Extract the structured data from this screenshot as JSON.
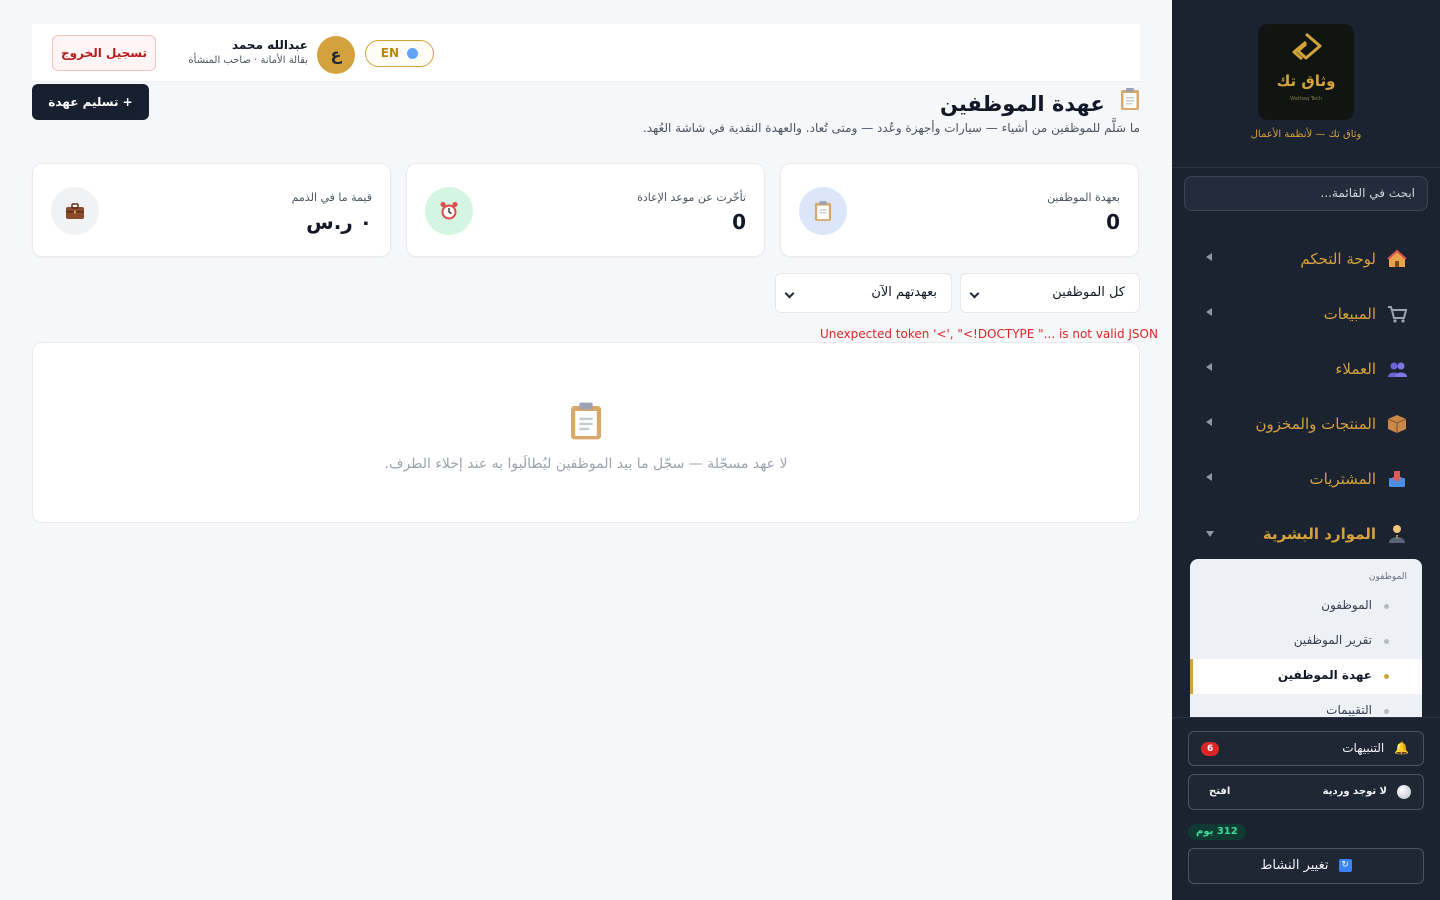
{
  "header": {
    "lang_label": "EN",
    "avatar_letter": "ع",
    "user_name": "عبدالله محمد",
    "user_role": "بقالة الأمانة · صاحب المنشأة",
    "logout_label": "تسجيل الخروج"
  },
  "page": {
    "title": "عهدة الموظفين",
    "subtitle": "ما سَلَّم للموظفين من أشياء — سيارات وأجهزة وعُدد — ومتى تُعاد. والعهدة النقدية في شاشة العُهد.",
    "deliver_button": "+  تسليم عهدة"
  },
  "stats": [
    {
      "label": "بعهدة الموظفين",
      "value": "0",
      "icon": "clipboard-icon"
    },
    {
      "label": "تأخّرت عن موعد الإعادة",
      "value": "0",
      "icon": "alarm-clock-icon"
    },
    {
      "label": "قيمة ما في الذمم",
      "value": "٠ ر.س",
      "icon": "briefcase-icon"
    }
  ],
  "filters": {
    "employee_select": "كل الموظفين",
    "status_select": "بعهدتهم الآن"
  },
  "error_message": "Unexpected token '<', \"<!DOCTYPE \"... is not valid JSON",
  "empty_state": {
    "text": "لا عهد مسجّلة — سجّل ما بيد الموظفين ليُطالَبوا به عند إخلاء الطرف."
  },
  "sidebar": {
    "logo_text": "وثاق تك",
    "logo_sub": "Wathaq Tech",
    "tagline": "وثاق تك — لأنظمة الأعمال",
    "search_placeholder": "ابحث في القائمة...",
    "items": [
      {
        "label": "لوحة التحكم",
        "icon": "house-icon"
      },
      {
        "label": "المبيعات",
        "icon": "cart-icon"
      },
      {
        "label": "العملاء",
        "icon": "users-icon"
      },
      {
        "label": "المنتجات والمخزون",
        "icon": "box-icon"
      },
      {
        "label": "المشتريات",
        "icon": "inbox-tray-icon"
      },
      {
        "label": "الموارد البشرية",
        "icon": "person-icon"
      }
    ],
    "submenu": {
      "heading": "الموظفون",
      "items": [
        "الموظفون",
        "تقرير الموظفين",
        "عهدة الموظفين",
        "التقييمات"
      ]
    },
    "notifications_label": "التنبيهات",
    "notifications_count": "6",
    "shift_label": "لا توجد وردية",
    "shift_open": "افتح",
    "days_left": "312 يوم",
    "switch_label": "تغيير النشاط"
  },
  "colors": {
    "accent": "#d4a23c",
    "sidebar_bg": "#1b2230",
    "danger": "#dc2626",
    "dark_button": "#182030"
  }
}
